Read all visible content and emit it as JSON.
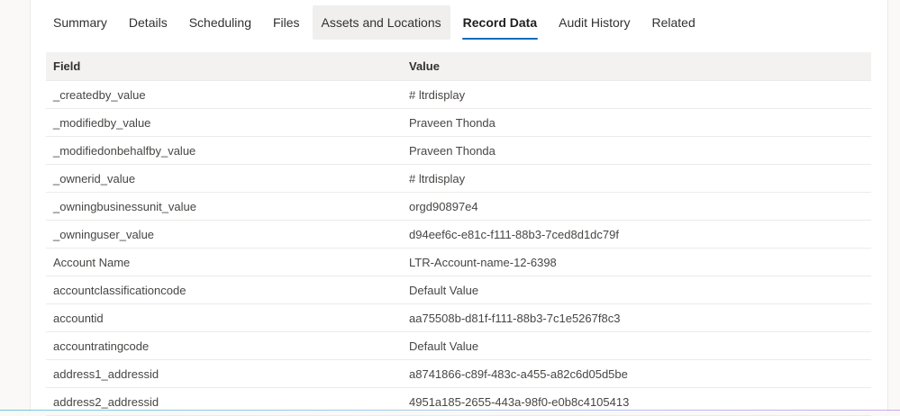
{
  "tabs": [
    {
      "label": "Summary"
    },
    {
      "label": "Details"
    },
    {
      "label": "Scheduling"
    },
    {
      "label": "Files"
    },
    {
      "label": "Assets and Locations"
    },
    {
      "label": "Record Data"
    },
    {
      "label": "Audit History"
    },
    {
      "label": "Related"
    }
  ],
  "active_tab": "Record Data",
  "hovered_tab": "Assets and Locations",
  "table": {
    "headers": {
      "field": "Field",
      "value": "Value"
    },
    "rows": [
      {
        "field": "_createdby_value",
        "value": "# ltrdisplay"
      },
      {
        "field": "_modifiedby_value",
        "value": "Praveen Thonda"
      },
      {
        "field": "_modifiedonbehalfby_value",
        "value": "Praveen Thonda"
      },
      {
        "field": "_ownerid_value",
        "value": "# ltrdisplay"
      },
      {
        "field": "_owningbusinessunit_value",
        "value": "orgd90897e4"
      },
      {
        "field": "_owninguser_value",
        "value": "d94eef6c-e81c-f111-88b3-7ced8d1dc79f"
      },
      {
        "field": "Account Name",
        "value": "LTR-Account-name-12-6398"
      },
      {
        "field": "accountclassificationcode",
        "value": "Default Value"
      },
      {
        "field": "accountid",
        "value": "aa75508b-d81f-f111-88b3-7c1e5267f8c3"
      },
      {
        "field": "accountratingcode",
        "value": "Default Value"
      },
      {
        "field": "address1_addressid",
        "value": "a8741866-c89f-483c-a455-a82c6d05d5be"
      },
      {
        "field": "address2_addressid",
        "value": "4951a185-2655-443a-98f0-e0b8c4105413"
      }
    ]
  },
  "colors": {
    "accent": "#0f6cbd",
    "header_bg": "#f3f2f1",
    "row_border": "#edebe9"
  }
}
